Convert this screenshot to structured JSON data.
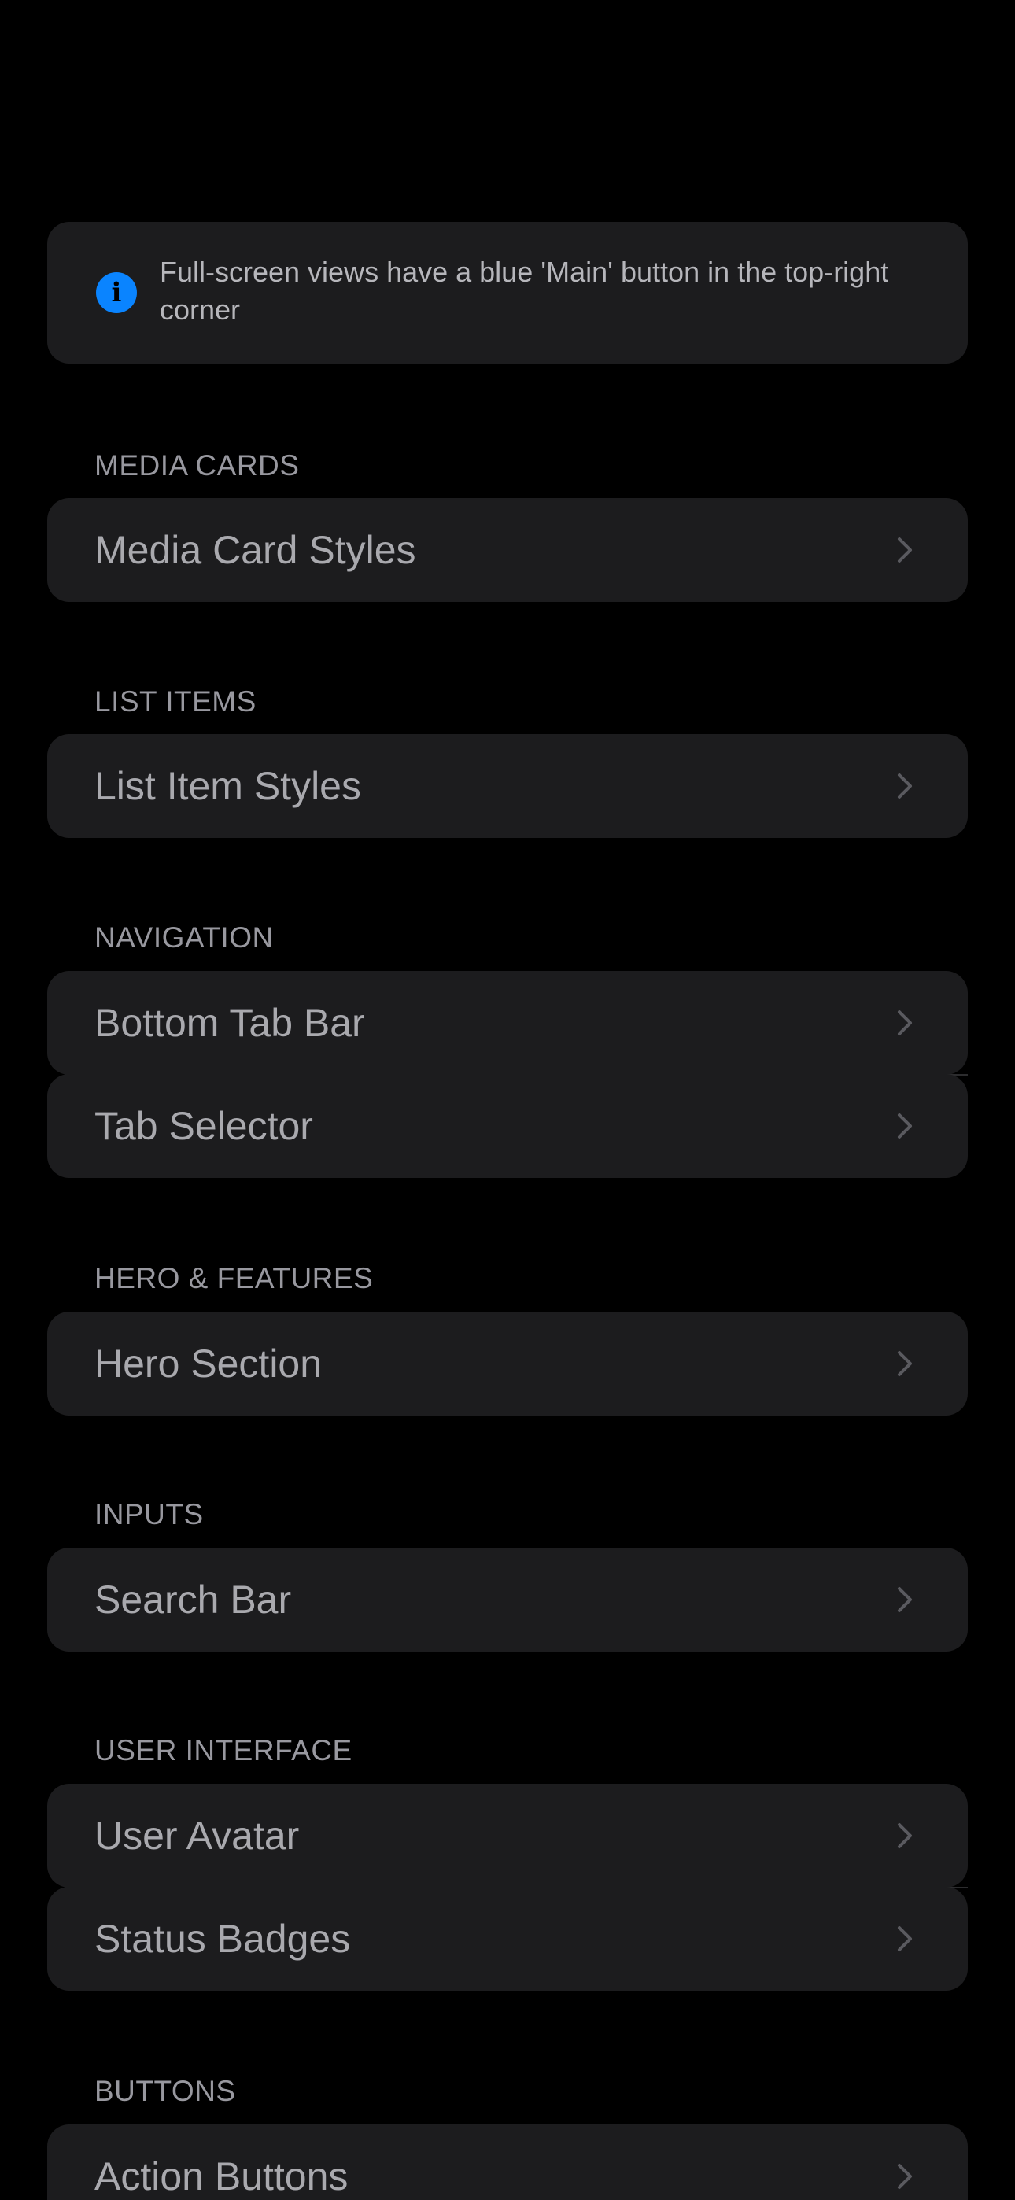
{
  "info_banner": {
    "icon": "info-icon",
    "icon_color": "#0a84ff",
    "text": "Full-screen views have a blue 'Main' button in the top-right corner"
  },
  "sections": [
    {
      "header": "MEDIA CARDS",
      "items": [
        {
          "label": "Media Card Styles"
        }
      ]
    },
    {
      "header": "LIST ITEMS",
      "items": [
        {
          "label": "List Item Styles"
        }
      ]
    },
    {
      "header": "NAVIGATION",
      "items": [
        {
          "label": "Bottom Tab Bar"
        },
        {
          "label": "Tab Selector"
        }
      ]
    },
    {
      "header": "HERO & FEATURES",
      "items": [
        {
          "label": "Hero Section"
        }
      ]
    },
    {
      "header": "INPUTS",
      "items": [
        {
          "label": "Search Bar"
        }
      ]
    },
    {
      "header": "USER INTERFACE",
      "items": [
        {
          "label": "User Avatar"
        },
        {
          "label": "Status Badges"
        }
      ]
    },
    {
      "header": "BUTTONS",
      "items": [
        {
          "label": "Action Buttons"
        }
      ]
    }
  ],
  "colors": {
    "background": "#000000",
    "card": "#1c1c1e",
    "header_text": "#98989f",
    "row_text": "#a9a9ae",
    "accent": "#0a84ff"
  }
}
